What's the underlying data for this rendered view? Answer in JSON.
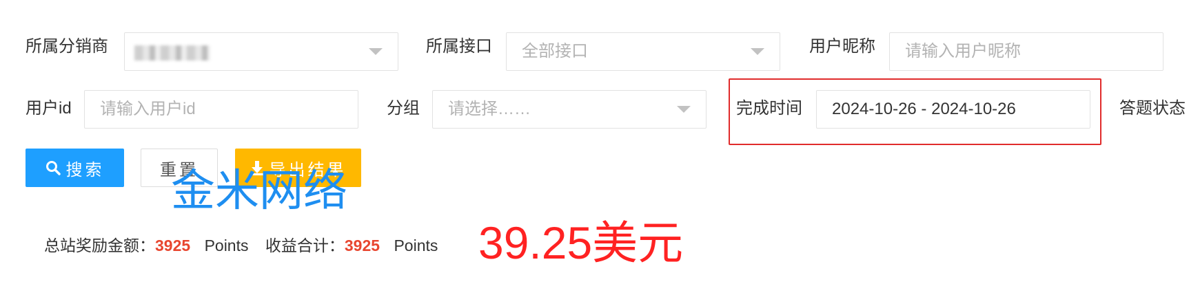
{
  "filters": {
    "distributor": {
      "label": "所属分销商"
    },
    "interface": {
      "label": "所属接口",
      "value": "全部接口"
    },
    "nickname": {
      "label": "用户昵称",
      "placeholder": "请输入用户昵称"
    },
    "user_id": {
      "label": "用户id",
      "placeholder": "请输入用户id"
    },
    "group": {
      "label": "分组",
      "placeholder": "请选择……"
    },
    "complete_time": {
      "label": "完成时间",
      "value": "2024-10-26 - 2024-10-26"
    },
    "answer_status": {
      "label": "答题状态"
    }
  },
  "buttons": {
    "search": "搜索",
    "reset": "重置",
    "export": "导出结果"
  },
  "watermark": "金米网络",
  "summary": {
    "total_reward_label": "总站奖励金额：",
    "total_reward_value": "3925",
    "total_reward_unit": "Points",
    "income_label": "收益合计：",
    "income_value": "3925",
    "income_unit": "Points",
    "usd_amount": "39.25美元"
  },
  "colors": {
    "primary": "#1e9fff",
    "warning": "#ffb800",
    "highlight_red": "#e02b2b",
    "amount_red": "#ff2222"
  },
  "icons": [
    "search-icon",
    "download-icon",
    "chevron-down-icon"
  ]
}
